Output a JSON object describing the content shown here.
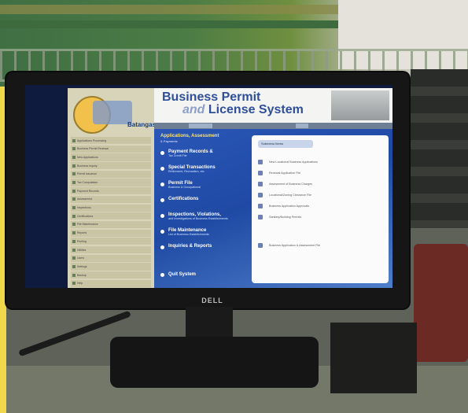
{
  "monitor": {
    "brand": "DELL"
  },
  "app": {
    "logo": {
      "text": "Batangas"
    },
    "banner": {
      "line1": "Business Permit",
      "line2_pre": "and",
      "line2_post": " License System"
    },
    "toolbar": {
      "left_text": "",
      "right_text": ""
    },
    "sidebar": {
      "items": [
        "Applications Processing",
        "Business Permit Renewal",
        "New Applications",
        "Business Inquiry",
        "Permit Issuance",
        "Tax Computation",
        "Payment Records",
        "Assessment",
        "Inspections",
        "Certifications",
        "File Maintenance",
        "Reports",
        "Printing",
        "Utilities",
        "Users",
        "Settings",
        "Backup",
        "Help"
      ],
      "footer": ""
    },
    "main": {
      "heading": "Applications, Assessment",
      "subheading": "& Payments",
      "commands": [
        {
          "title": "Payment Records &",
          "desc": "Tax Credit File"
        },
        {
          "title": "Special Transactions",
          "desc": "Retirement, Revocation, etc."
        },
        {
          "title": "Permit File",
          "desc": "Business & Occupational"
        },
        {
          "title": "Certifications",
          "desc": ""
        },
        {
          "title": "Inspections, Violations,",
          "desc": "and Investigations of Business Establishments"
        },
        {
          "title": "File Maintenance",
          "desc": "List of Business Establishments"
        },
        {
          "title": "Inquiries & Reports",
          "desc": ""
        }
      ],
      "quit": "Quit System"
    },
    "panel": {
      "tab": "Submenu Items",
      "items": [
        "New Locational Business Applications",
        "Renewal Application File",
        "Assessment of Business Charges",
        "Locational/Zoning Clearance File",
        "Business Application Approvals",
        "Sanitary/Building Permits"
      ],
      "last_item": "Business Application & Assessment File"
    }
  }
}
